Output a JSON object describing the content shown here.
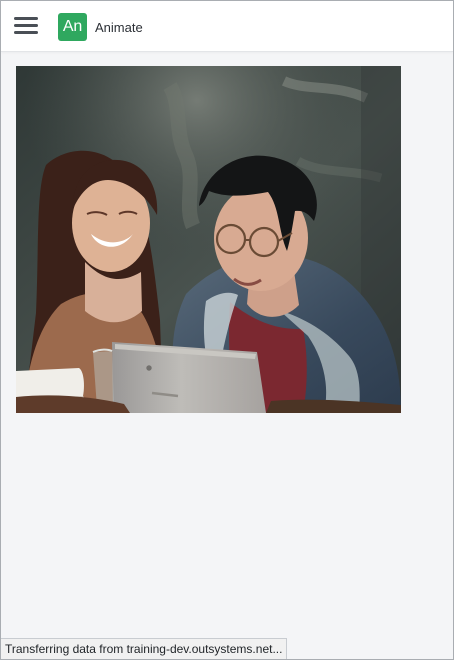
{
  "header": {
    "menu_icon": "hamburger-menu-icon",
    "logo_text": "An",
    "logo_color": "#2fa85f",
    "app_title": "Animate"
  },
  "main": {
    "image_subject": "photo"
  },
  "browser": {
    "status_text": "Transferring data from training-dev.outsystems.net..."
  }
}
